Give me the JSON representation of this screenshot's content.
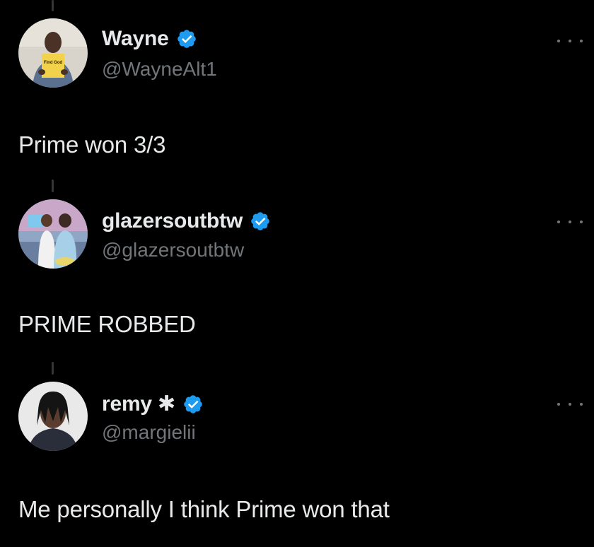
{
  "colors": {
    "background": "#000000",
    "text_primary": "#e7e9ea",
    "text_secondary": "#71767b",
    "verified_badge": "#1d9bf0",
    "thread_line": "#333639"
  },
  "tweets": [
    {
      "display_name": "Wayne",
      "handle": "@WayneAlt1",
      "verified": true,
      "avatar_icon": "avatar-wayne",
      "avatar_sign_text": "Find God",
      "text": "Prime won 3/3",
      "more_icon": "more-horizontal-icon"
    },
    {
      "display_name": "glazersoutbtw",
      "handle": "@glazersoutbtw",
      "verified": true,
      "avatar_icon": "avatar-glazersoutbtw",
      "text": "PRIME ROBBED",
      "more_icon": "more-horizontal-icon"
    },
    {
      "display_name": "remy ✱",
      "handle": "@margielii",
      "verified": true,
      "avatar_icon": "avatar-remy",
      "text": "Me personally I think Prime won that",
      "more_icon": "more-horizontal-icon"
    }
  ]
}
